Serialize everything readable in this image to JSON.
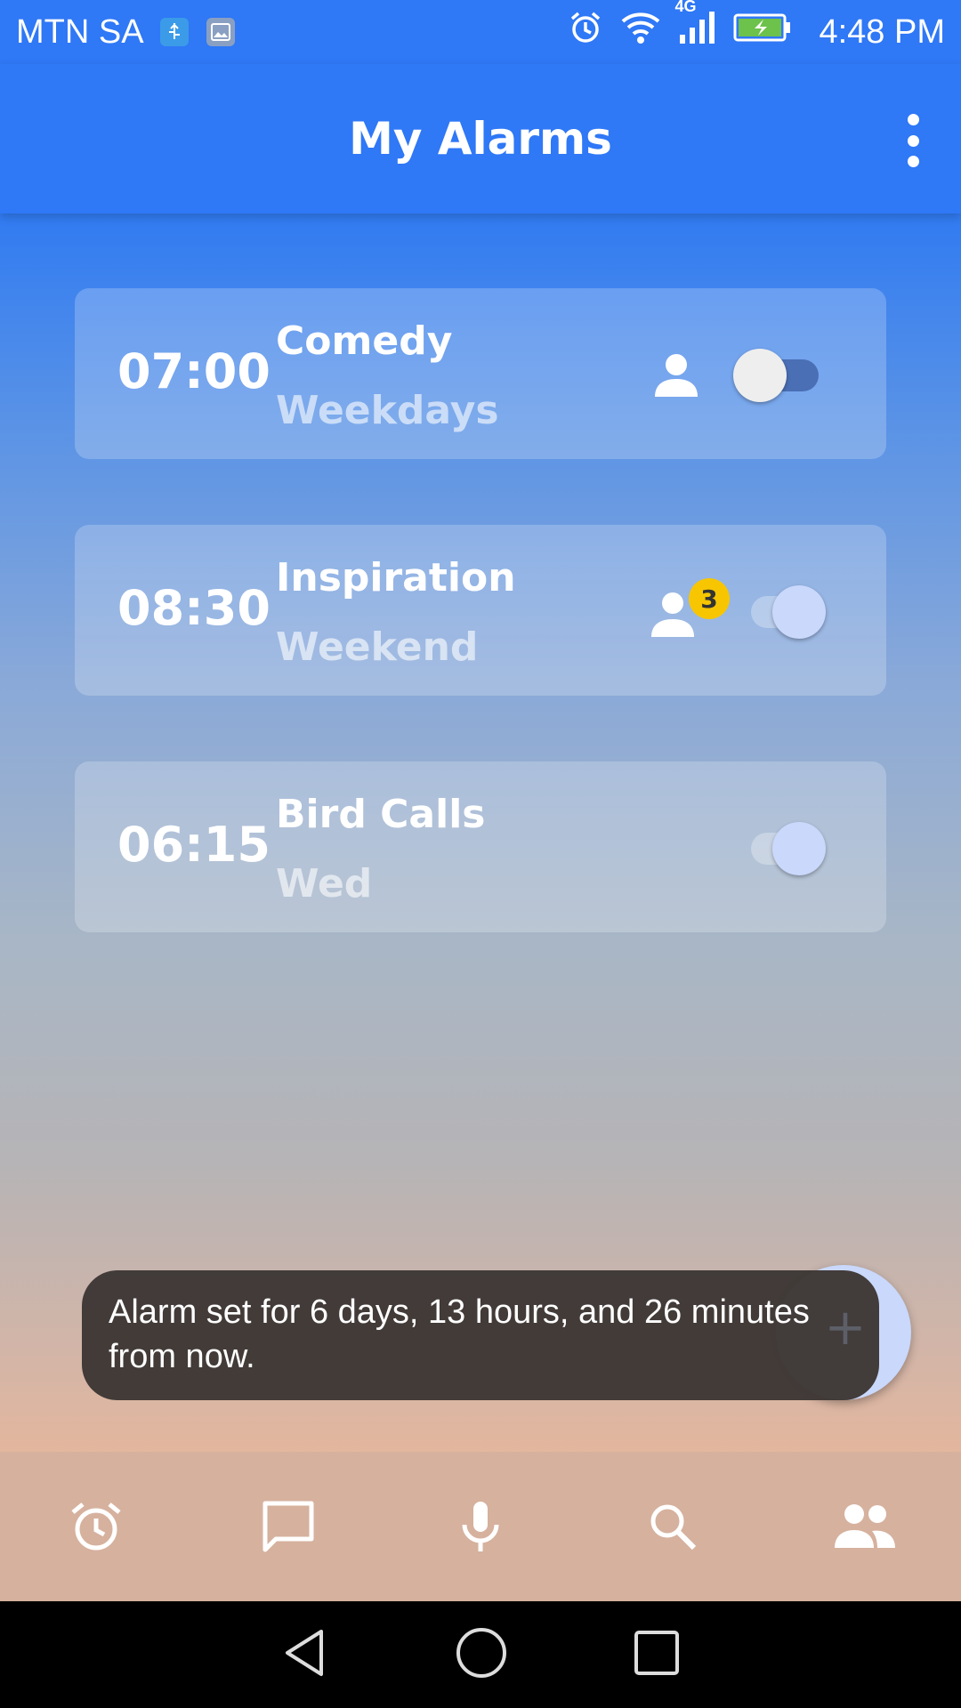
{
  "status_bar": {
    "carrier": "MTN SA",
    "network_type": "4G",
    "time": "4:48 PM",
    "icons": [
      "usb-icon",
      "image-icon",
      "alarm-icon",
      "wifi-icon",
      "signal-icon",
      "battery-charging-icon"
    ]
  },
  "app_bar": {
    "title": "My Alarms",
    "menu_icon": "overflow-menu-icon"
  },
  "alarms": [
    {
      "time": "07:00",
      "name": "Comedy",
      "days": "Weekdays",
      "sharing_icon": "person-icon",
      "enabled": false
    },
    {
      "time": "08:30",
      "name": "Inspiration",
      "days": "Weekend",
      "sharing_icon": "group-icon",
      "shared_count": "3",
      "enabled": true
    },
    {
      "time": "06:15",
      "name": "Bird Calls",
      "days": "Wed",
      "enabled": true
    }
  ],
  "toast": {
    "message": "Alarm set for 6 days, 13 hours, and 26 minutes from now."
  },
  "fab": {
    "icon": "plus-icon",
    "label": "+"
  },
  "bottom_nav": {
    "items": [
      "alarm-icon",
      "chat-icon",
      "mic-icon",
      "search-icon",
      "people-icon"
    ],
    "active": "alarm-icon"
  },
  "system_nav": [
    "back-icon",
    "home-icon",
    "recents-icon"
  ],
  "colors": {
    "primary": "#2f78f6",
    "badge": "#f7c600",
    "toast_bg": "#3d3735",
    "bottom_nav_bg": "#d6b19e"
  }
}
